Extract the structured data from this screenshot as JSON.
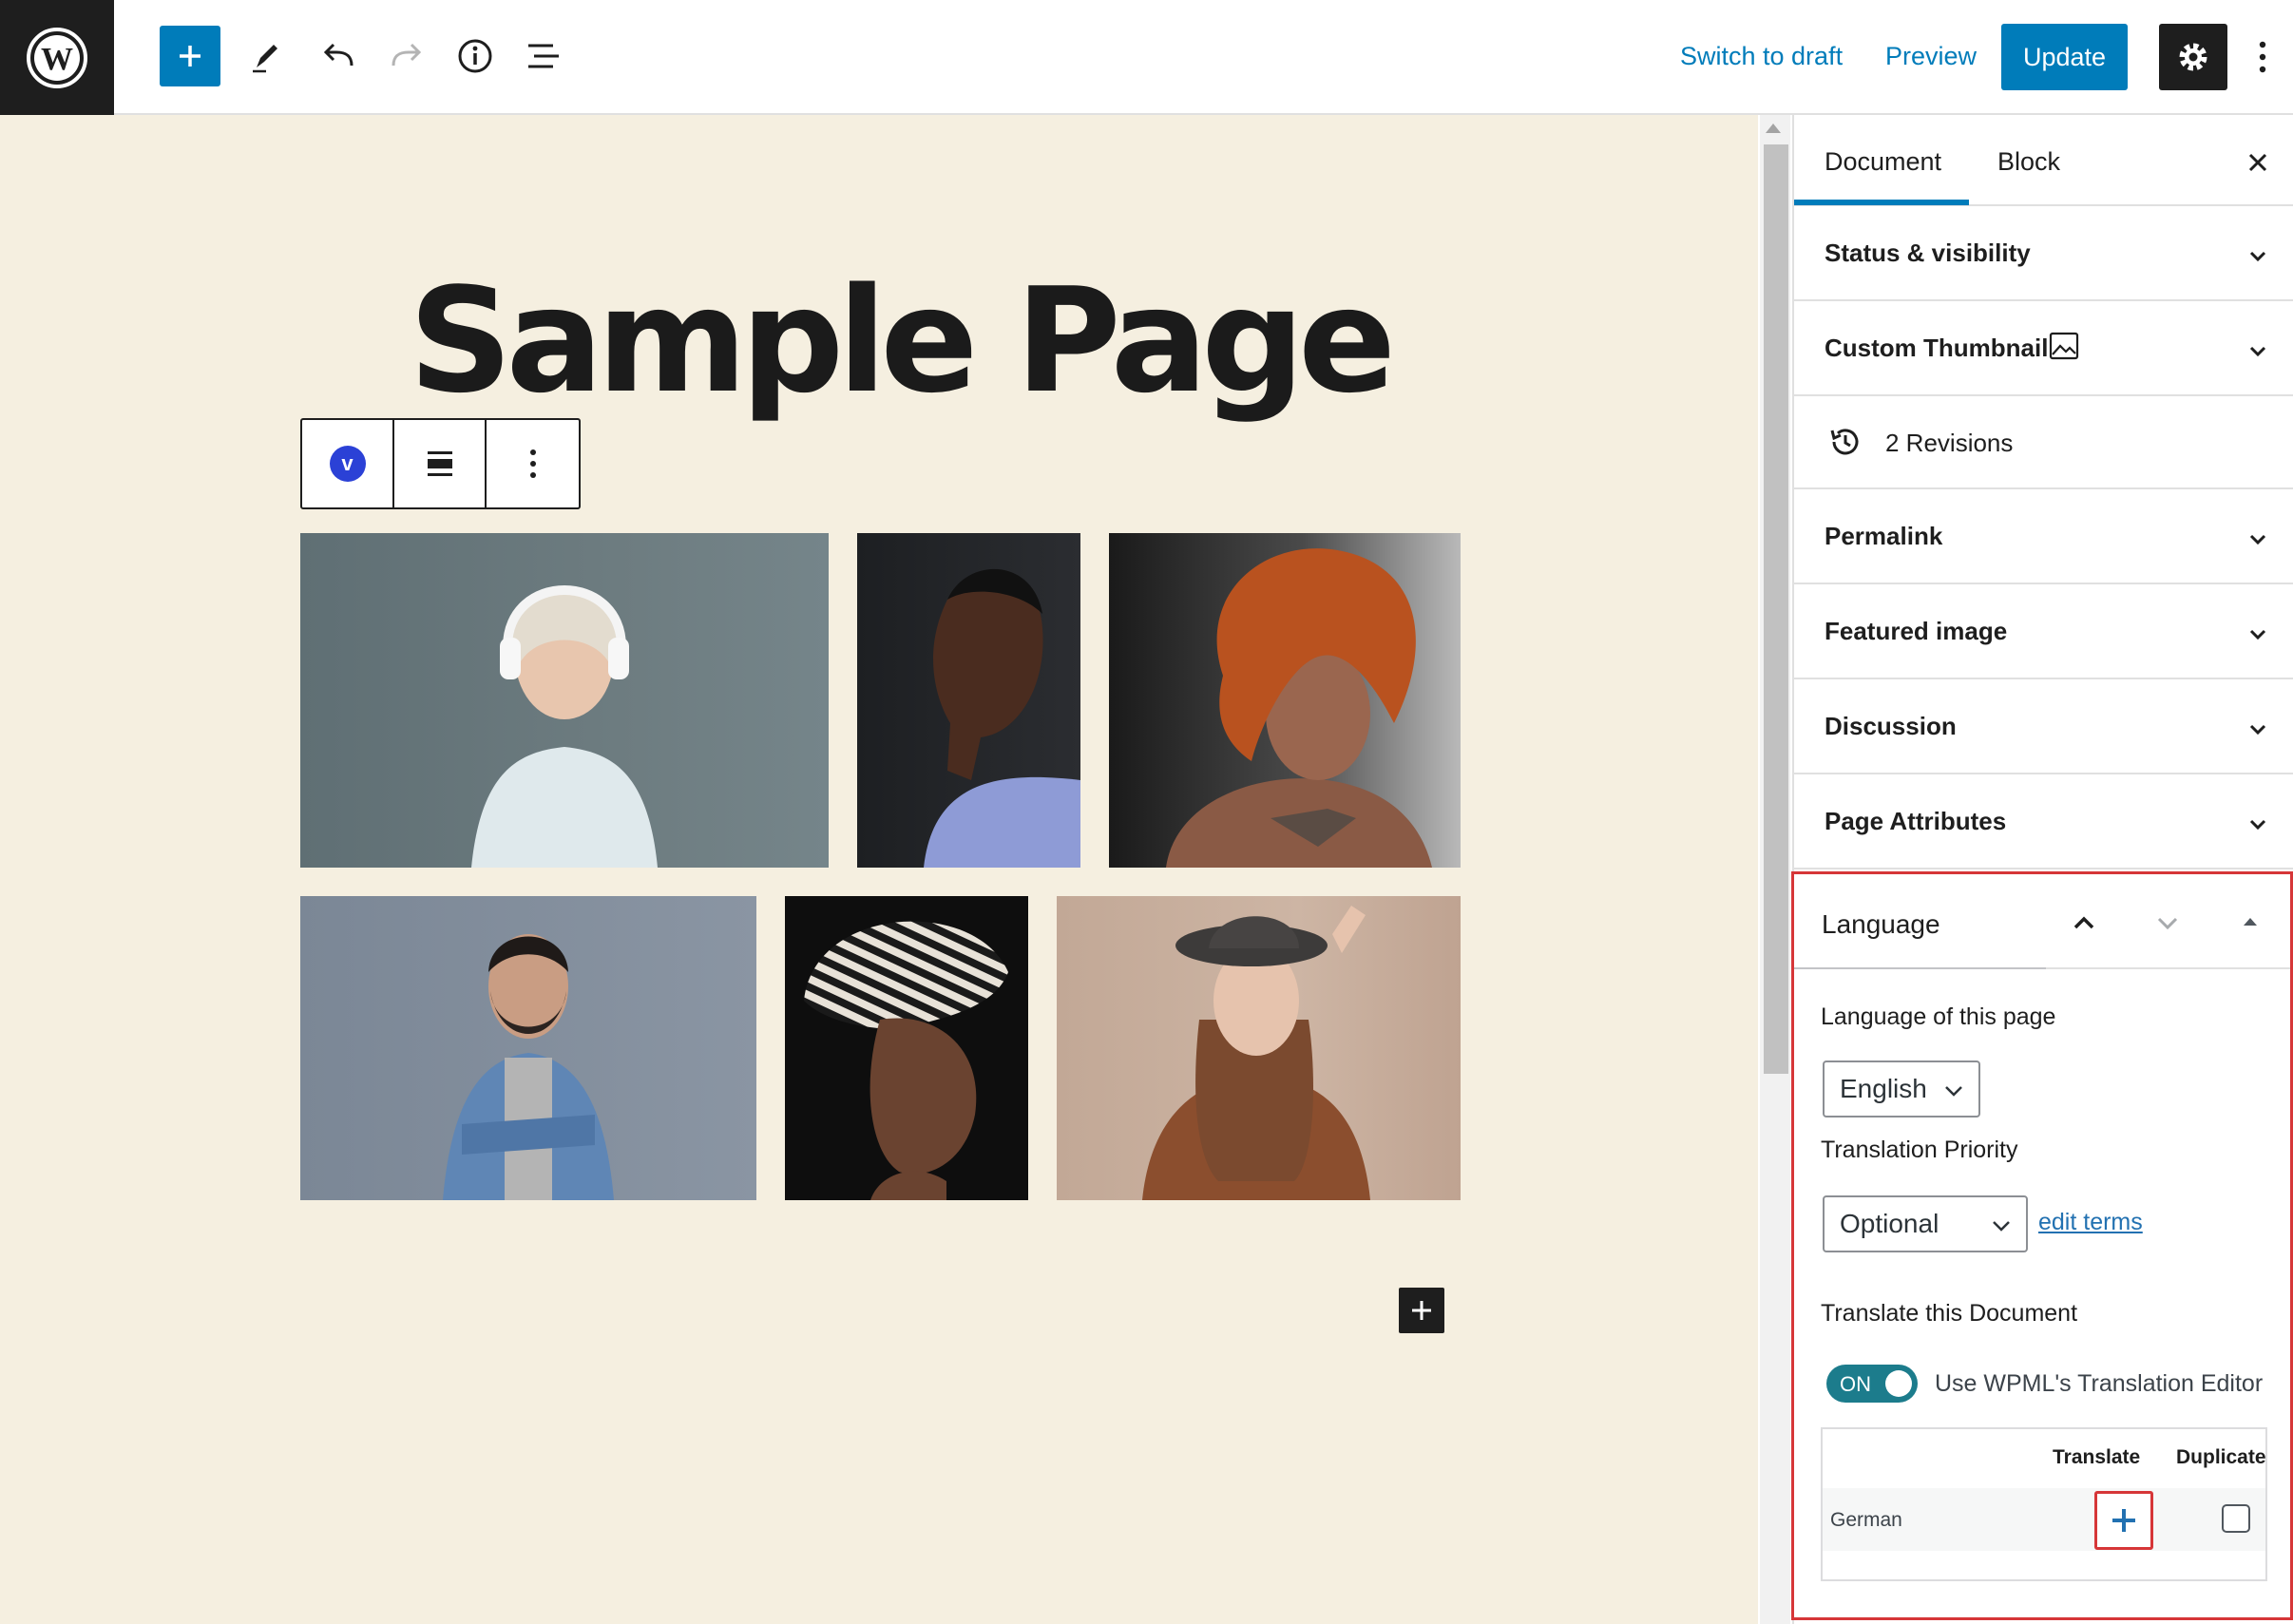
{
  "toolbar": {
    "switch_to_draft": "Switch to draft",
    "preview": "Preview",
    "update": "Update",
    "icons": [
      "wordpress-logo",
      "plus-icon",
      "pencil-icon",
      "undo-icon",
      "redo-icon",
      "info-icon",
      "list-view-icon",
      "gear-icon",
      "more-vertical-icon"
    ]
  },
  "editor": {
    "title": "Sample Page",
    "block_toolbar": {
      "block_icon_letter": "v"
    }
  },
  "sidebar": {
    "tabs": {
      "document": "Document",
      "block": "Block"
    },
    "panels": {
      "status": "Status & visibility",
      "custom_thumbnail": "Custom Thumbnail",
      "revisions": "2 Revisions",
      "permalink": "Permalink",
      "featured_image": "Featured image",
      "discussion": "Discussion",
      "page_attributes": "Page Attributes"
    },
    "language": {
      "title": "Language",
      "language_of_page_label": "Language of this page",
      "language_value": "English",
      "translation_priority_label": "Translation Priority",
      "priority_value": "Optional",
      "edit_terms": "edit terms",
      "translate_doc_label": "Translate this Document",
      "toggle_state": "ON",
      "toggle_label": "Use WPML's Translation Editor",
      "table": {
        "col_translate": "Translate",
        "col_duplicate": "Duplicate",
        "rows": [
          {
            "language": "German"
          }
        ]
      }
    }
  },
  "colors": {
    "accent": "#007cba",
    "canvas_bg": "#f5efe0",
    "highlight": "#d63638",
    "toggle_on": "#1c7c8c"
  }
}
